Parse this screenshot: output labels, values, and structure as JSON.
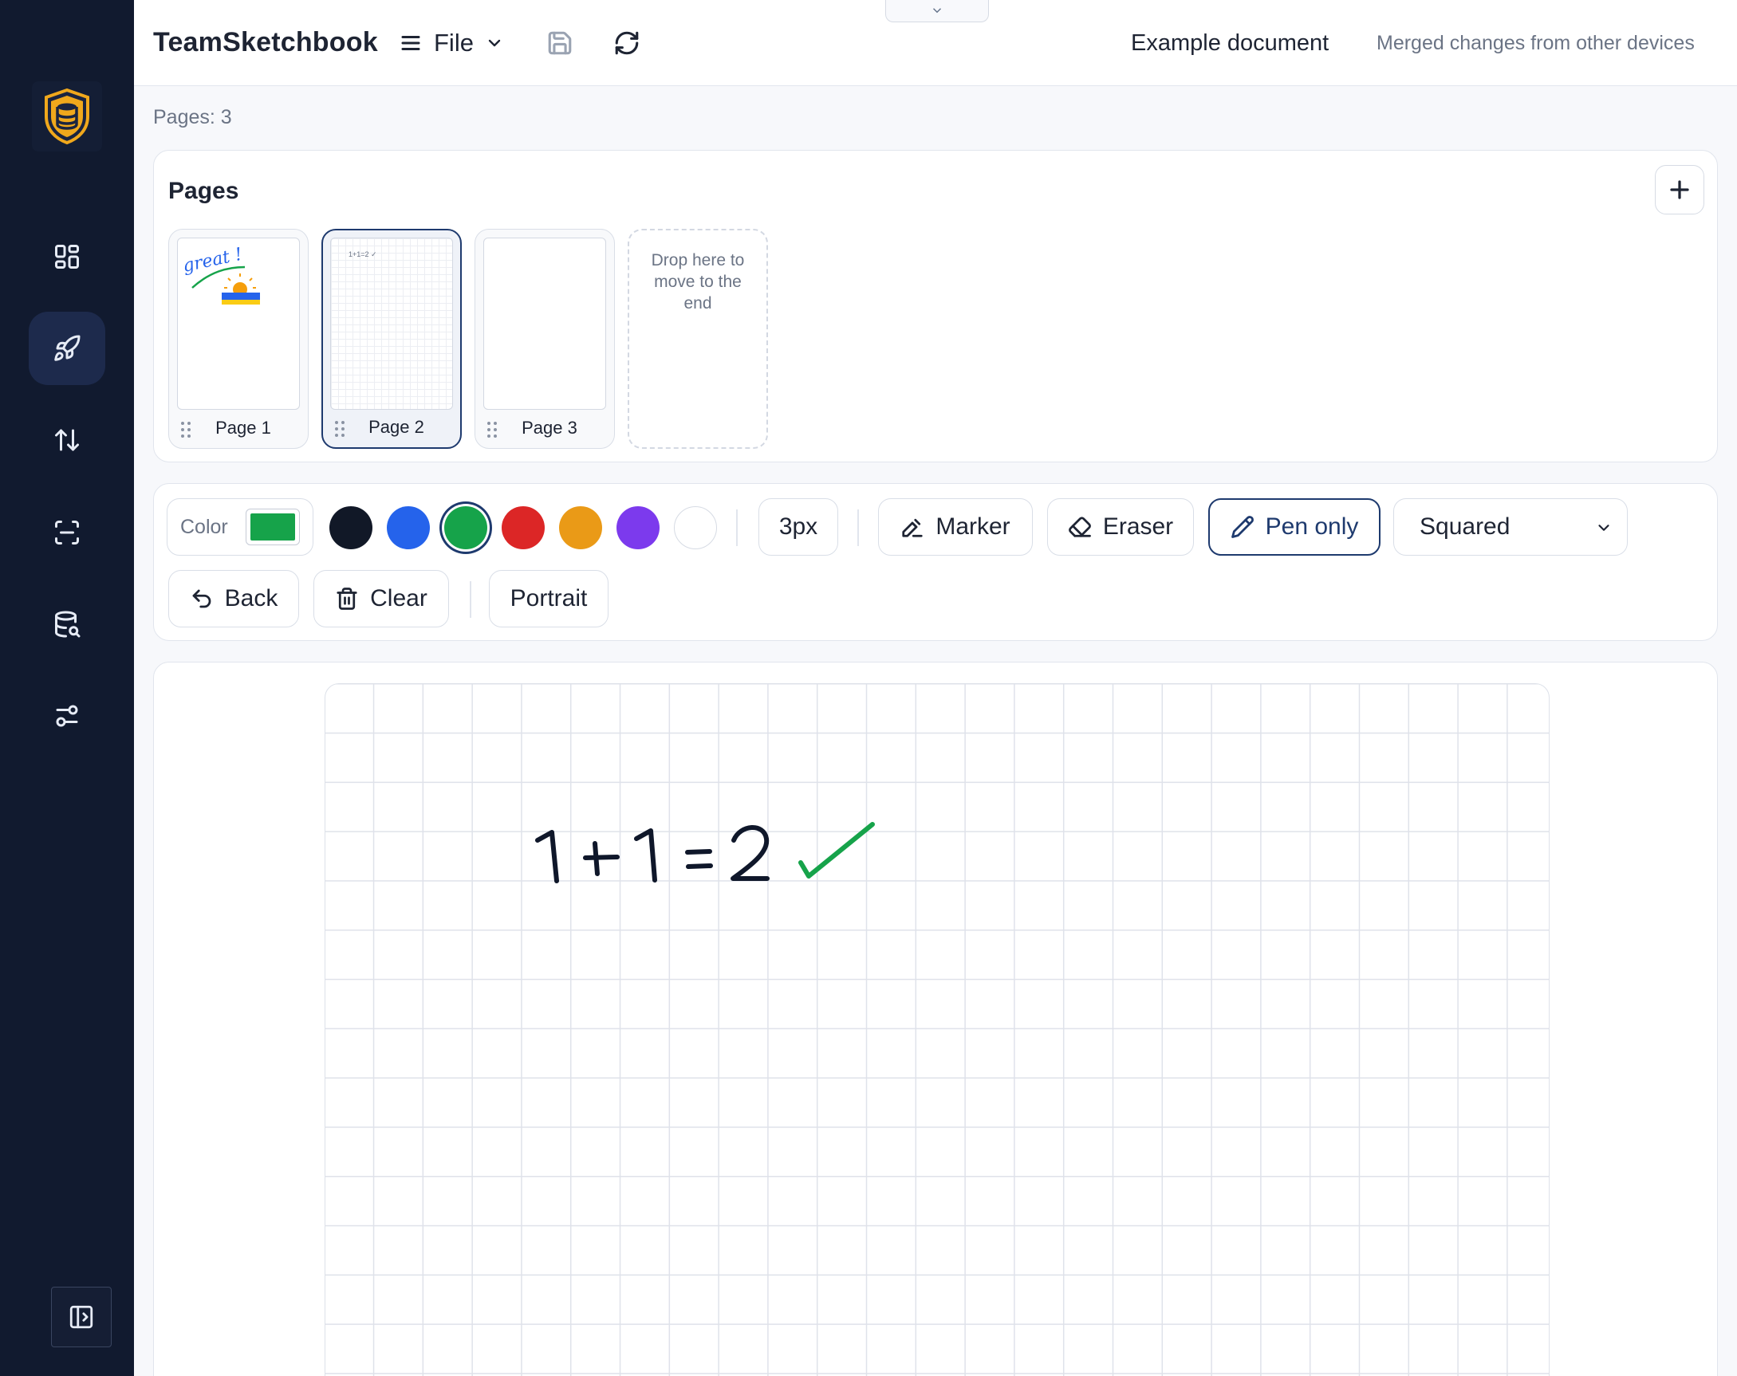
{
  "app": {
    "name": "TeamSketchbook",
    "file_menu_label": "File",
    "document_title": "Example document",
    "sync_status": "Merged changes from other devices"
  },
  "sidebar": {
    "logo_icon": "database-shield-logo",
    "items": [
      {
        "icon": "dashboard-icon",
        "active": false
      },
      {
        "icon": "rocket-icon",
        "active": true
      },
      {
        "icon": "arrows-up-down-icon",
        "active": false
      },
      {
        "icon": "scan-icon",
        "active": false
      },
      {
        "icon": "database-search-icon",
        "active": false
      },
      {
        "icon": "settings-sliders-icon",
        "active": false
      }
    ],
    "collapse_icon": "sidebar-expand-icon"
  },
  "main": {
    "pages_count": "Pages: 3",
    "pages_panel": {
      "title": "Pages",
      "pages": [
        {
          "label": "Page 1",
          "thumb_text": "great !",
          "selected": false
        },
        {
          "label": "Page 2",
          "thumb_text": "1+1=2 ✓",
          "selected": true
        },
        {
          "label": "Page 3",
          "thumb_text": "",
          "selected": false
        }
      ],
      "drop_zone_text": "Drop here to move to the end"
    },
    "toolbar": {
      "color_label": "Color",
      "current_color": "#16a34a",
      "palette": [
        "#111827",
        "#2563eb",
        "#16a34a",
        "#dc2626",
        "#ea9a17",
        "#7c3aed",
        "#ffffff"
      ],
      "selected_palette_index": 2,
      "stroke_width": "3px",
      "marker_label": "Marker",
      "eraser_label": "Eraser",
      "pen_only_label": "Pen only",
      "pen_only_active": true,
      "paper_style": "Squared",
      "back_label": "Back",
      "clear_label": "Clear",
      "orientation_label": "Portrait"
    },
    "canvas": {
      "background": "squared",
      "ink_text": "1 + 1 = 2",
      "ink_color": "#0f172a",
      "check_color": "#16a34a"
    }
  }
}
